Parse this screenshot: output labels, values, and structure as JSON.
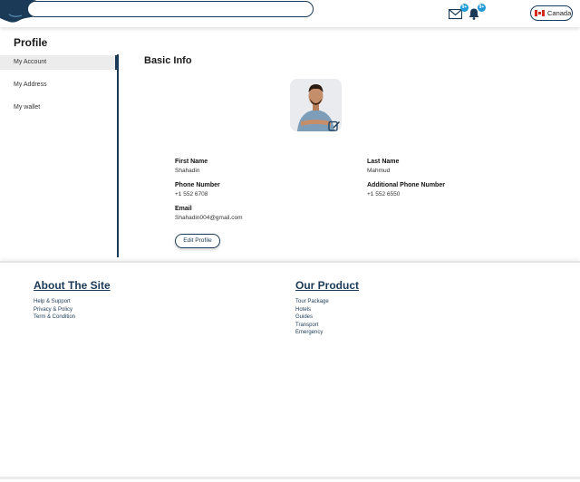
{
  "header": {
    "search": {
      "value": "",
      "placeholder": ""
    },
    "messages_badge": "9+",
    "notifications_badge": "9+",
    "country": "Canada",
    "accent_color": "#1b3a57",
    "badge_color": "#1f9ad6"
  },
  "sidebar": {
    "title": "Profile",
    "items": [
      {
        "label": "My Account",
        "active": true
      },
      {
        "label": "My Address",
        "active": false
      },
      {
        "label": "My wallet",
        "active": false
      }
    ]
  },
  "main": {
    "section_title": "Basic Info",
    "fields": {
      "first_name": {
        "label": "First Name",
        "value": "Shahadin"
      },
      "last_name": {
        "label": "Last Name",
        "value": "Mahmud"
      },
      "phone": {
        "label": "Phone Number",
        "value": "+1 552 6708"
      },
      "additional_phone": {
        "label": "Additional Phone Number",
        "value": "+1 552 6550"
      },
      "email": {
        "label": "Email",
        "value": "Shahadin004@gmail.com"
      }
    },
    "edit_button": "Edit Profile"
  },
  "footer": {
    "about": {
      "title": "About The Site",
      "links": [
        "Help & Support",
        "Privacy & Policy",
        "Term & Condition"
      ]
    },
    "product": {
      "title": "Our Product",
      "links": [
        "Tour Package",
        "Hotels",
        "Guides",
        "Transport",
        "Emergency"
      ]
    }
  }
}
